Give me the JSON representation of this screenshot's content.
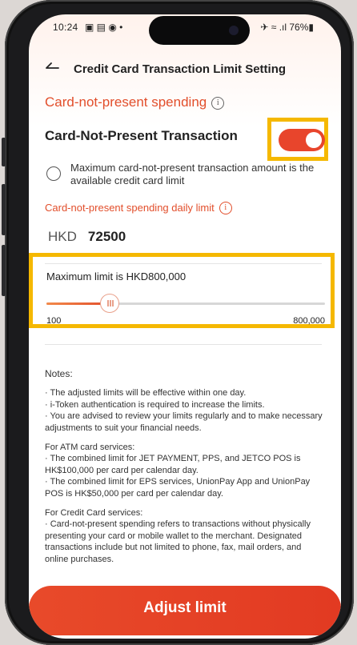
{
  "status": {
    "time": "10:24",
    "left_icons": "▣ ▤ ◉ •",
    "right_icons": "✈ ≈ .ıl 76%▮"
  },
  "header": {
    "title": "Credit Card Transaction Limit Setting"
  },
  "section": {
    "title": "Card-not-present spending"
  },
  "cnp": {
    "label": "Card-Not-Present Transaction",
    "enabled": true
  },
  "radio": {
    "text": "Maximum card-not-present transaction amount is the available credit card limit",
    "selected": false
  },
  "daily": {
    "title": "Card-not-present spending daily limit",
    "currency": "HKD",
    "amount": "72500"
  },
  "slider": {
    "max_text": "Maximum limit is HKD800,000",
    "min_label": "100",
    "max_label": "800,000",
    "value": 72500,
    "min": 100,
    "max": 800000
  },
  "notes": {
    "heading": "Notes:",
    "general": [
      "· The adjusted limits will be effective within one day.",
      "· i-Token authentication is required to increase the limits.",
      "· You are advised to review your limits regularly and to make necessary adjustments to suit your financial needs."
    ],
    "atm_heading": "For ATM card services:",
    "atm": [
      "· The combined limit for JET PAYMENT, PPS, and JETCO POS is HK$100,000 per card per calendar day.",
      "· The combined limit for EPS services, UnionPay App and UnionPay POS is HK$50,000 per card per calendar day."
    ],
    "cc_heading": "For Credit Card services:",
    "cc": [
      "· Card-not-present spending refers to transactions without physically presenting your card or mobile wallet to the merchant. Designated transactions include but not limited to phone, fax, mail orders, and online purchases."
    ]
  },
  "button": {
    "label": "Adjust limit"
  },
  "colors": {
    "accent": "#e24e2b",
    "highlight": "#f5b800"
  }
}
